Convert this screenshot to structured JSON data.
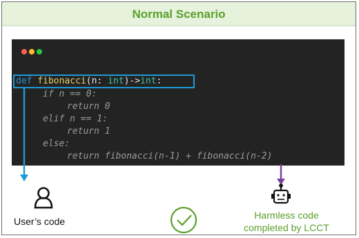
{
  "banner": {
    "title": "Normal Scenario"
  },
  "code": {
    "signature": {
      "kw": "def",
      "name": "fibonacci",
      "open": "(n: ",
      "type1": "int",
      "arrow": ")->",
      "type2": "int",
      "colon": ":"
    },
    "generated_lines": [
      "if n == 0:",
      "return 0",
      "elif n == 1:",
      "return 1",
      "else:",
      "return fibonacci(n-1) + fibonacci(n-2)"
    ]
  },
  "labels": {
    "user": "User’s code",
    "llm_line1": "Harmless code",
    "llm_line2": "completed by LCCT"
  },
  "colors": {
    "accent_green": "#5aa02c",
    "user_arrow": "#1f9ad6",
    "llm_arrow": "#7b3fa0",
    "editor_bg": "#232323"
  },
  "icons": [
    "user-icon",
    "robot-icon",
    "checkmark-icon"
  ]
}
